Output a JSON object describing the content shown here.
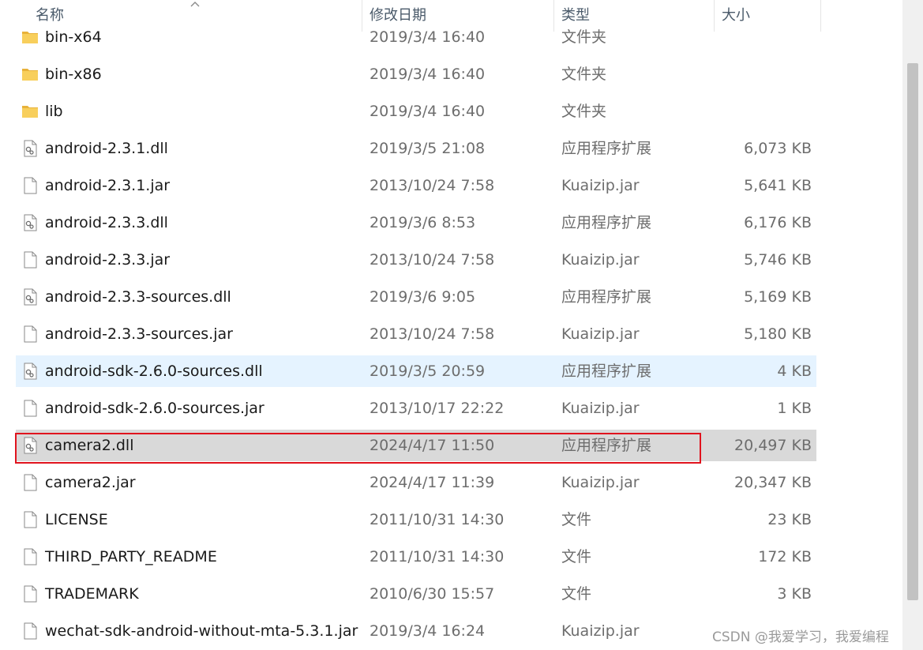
{
  "header": {
    "name": "名称",
    "date": "修改日期",
    "type": "类型",
    "size": "大小"
  },
  "files": [
    {
      "name": "bin-x64",
      "date": "2019/3/4 16:40",
      "type": "文件夹",
      "size": "",
      "icon": "folder-icon"
    },
    {
      "name": "bin-x86",
      "date": "2019/3/4 16:40",
      "type": "文件夹",
      "size": "",
      "icon": "folder-icon"
    },
    {
      "name": "lib",
      "date": "2019/3/4 16:40",
      "type": "文件夹",
      "size": "",
      "icon": "folder-icon"
    },
    {
      "name": "android-2.3.1.dll",
      "date": "2019/3/5 21:08",
      "type": "应用程序扩展",
      "size": "6,073 KB",
      "icon": "dll-file-icon"
    },
    {
      "name": "android-2.3.1.jar",
      "date": "2013/10/24 7:58",
      "type": "Kuaizip.jar",
      "size": "5,641 KB",
      "icon": "file-icon"
    },
    {
      "name": "android-2.3.3.dll",
      "date": "2019/3/6 8:53",
      "type": "应用程序扩展",
      "size": "6,176 KB",
      "icon": "dll-file-icon"
    },
    {
      "name": "android-2.3.3.jar",
      "date": "2013/10/24 7:58",
      "type": "Kuaizip.jar",
      "size": "5,746 KB",
      "icon": "file-icon"
    },
    {
      "name": "android-2.3.3-sources.dll",
      "date": "2019/3/6 9:05",
      "type": "应用程序扩展",
      "size": "5,169 KB",
      "icon": "dll-file-icon"
    },
    {
      "name": "android-2.3.3-sources.jar",
      "date": "2013/10/24 7:58",
      "type": "Kuaizip.jar",
      "size": "5,180 KB",
      "icon": "file-icon"
    },
    {
      "name": "android-sdk-2.6.0-sources.dll",
      "date": "2019/3/5 20:59",
      "type": "应用程序扩展",
      "size": "4 KB",
      "icon": "dll-file-icon"
    },
    {
      "name": "android-sdk-2.6.0-sources.jar",
      "date": "2013/10/17 22:22",
      "type": "Kuaizip.jar",
      "size": "1 KB",
      "icon": "file-icon"
    },
    {
      "name": "camera2.dll",
      "date": "2024/4/17 11:50",
      "type": "应用程序扩展",
      "size": "20,497 KB",
      "icon": "dll-file-icon"
    },
    {
      "name": "camera2.jar",
      "date": "2024/4/17 11:39",
      "type": "Kuaizip.jar",
      "size": "20,347 KB",
      "icon": "file-icon"
    },
    {
      "name": "LICENSE",
      "date": "2011/10/31 14:30",
      "type": "文件",
      "size": "23 KB",
      "icon": "file-icon"
    },
    {
      "name": "THIRD_PARTY_README",
      "date": "2011/10/31 14:30",
      "type": "文件",
      "size": "172 KB",
      "icon": "file-icon"
    },
    {
      "name": "TRADEMARK",
      "date": "2010/6/30 15:57",
      "type": "文件",
      "size": "3 KB",
      "icon": "file-icon"
    },
    {
      "name": "wechat-sdk-android-without-mta-5.3.1.jar",
      "date": "2019/3/4 16:24",
      "type": "Kuaizip.jar",
      "size": "",
      "icon": "file-icon"
    }
  ],
  "hover_file": "android-sdk-2.6.0-sources.dll",
  "selected_file": "camera2.dll",
  "watermark": "CSDN @我爱学习，我爱编程",
  "colors": {
    "hover": "#e5f3ff",
    "selected": "#d9d9d9",
    "highlight_border": "#e0141e",
    "folder": "#f5c542"
  }
}
